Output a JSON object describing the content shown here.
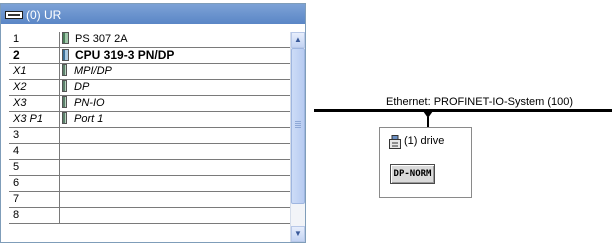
{
  "rack": {
    "title": "(0) UR",
    "rows": [
      {
        "slot": "1",
        "module": "PS 307 2A",
        "style": "normal",
        "icon": "module-icon"
      },
      {
        "slot": "2",
        "module": "CPU 319-3 PN/DP",
        "style": "bold",
        "icon": "cpu-icon"
      },
      {
        "slot": "X1",
        "module": "MPI/DP",
        "style": "italic",
        "icon": "submodule-icon"
      },
      {
        "slot": "X2",
        "module": "DP",
        "style": "italic",
        "icon": "submodule-icon"
      },
      {
        "slot": "X3",
        "module": "PN-IO",
        "style": "italic",
        "icon": "submodule-icon"
      },
      {
        "slot": "X3 P1",
        "module": "Port 1",
        "style": "italic",
        "icon": "submodule-icon"
      },
      {
        "slot": "3",
        "module": "",
        "style": "normal",
        "icon": ""
      },
      {
        "slot": "4",
        "module": "",
        "style": "normal",
        "icon": ""
      },
      {
        "slot": "5",
        "module": "",
        "style": "normal",
        "icon": ""
      },
      {
        "slot": "6",
        "module": "",
        "style": "normal",
        "icon": ""
      },
      {
        "slot": "7",
        "module": "",
        "style": "normal",
        "icon": ""
      },
      {
        "slot": "8",
        "module": "",
        "style": "normal",
        "icon": ""
      }
    ]
  },
  "network": {
    "bus_label": "Ethernet: PROFINET-IO-System (100)"
  },
  "device": {
    "label": "(1) drive",
    "type_label": "DP-NORM",
    "icon": "io-device-icon"
  },
  "colors": {
    "title_bar": "#5a86c6",
    "bus": "#000000"
  }
}
